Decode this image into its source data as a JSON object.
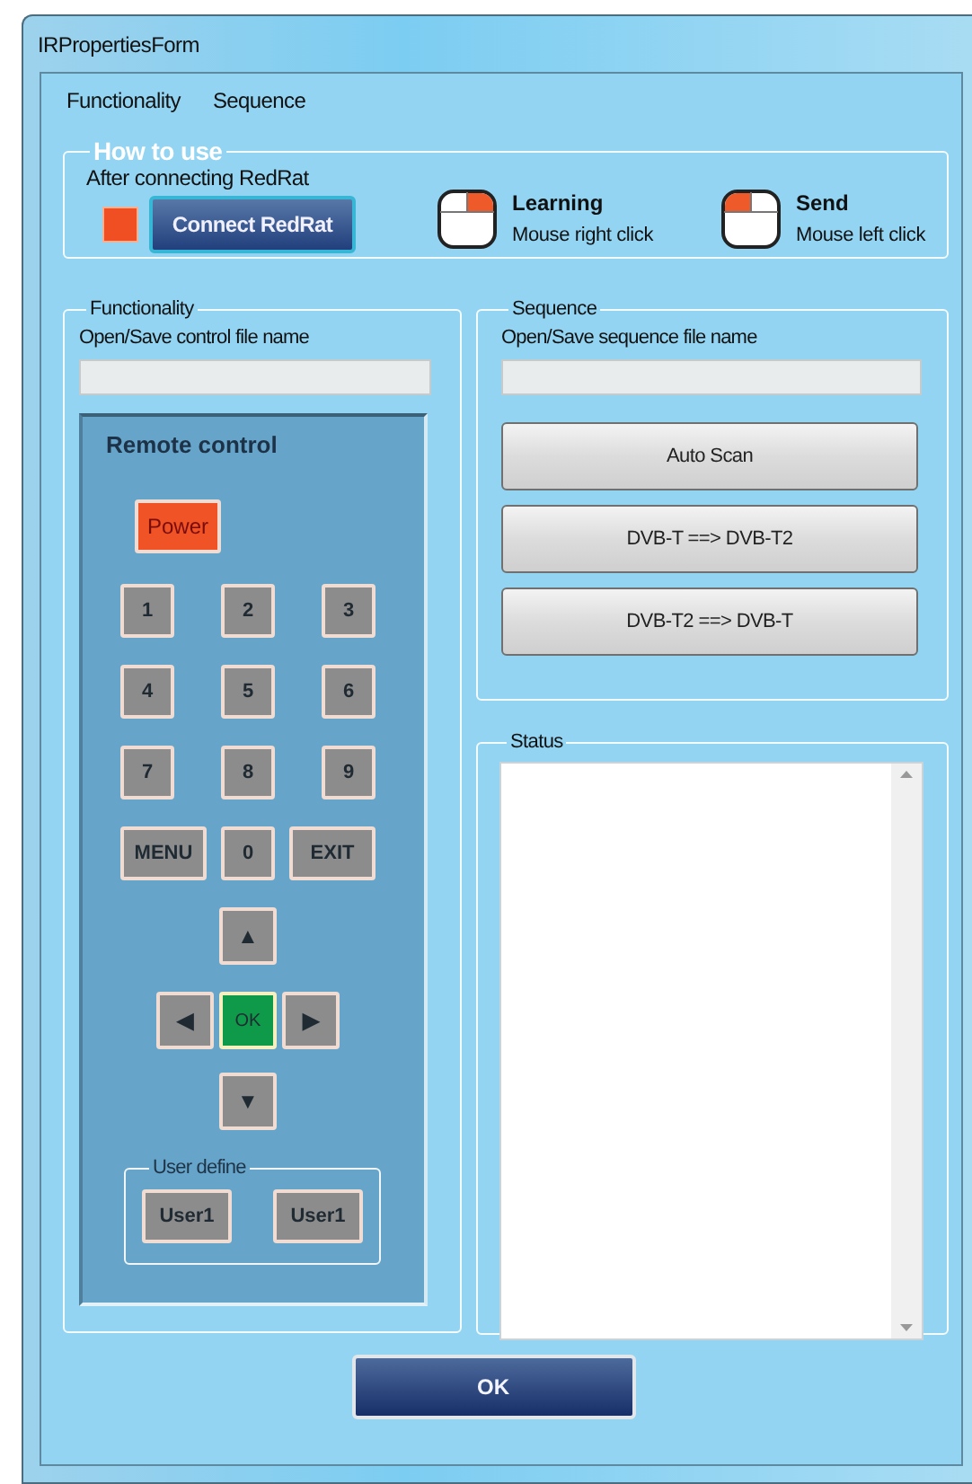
{
  "window": {
    "title": "IRPropertiesForm"
  },
  "menu": [
    {
      "label": "Functionality"
    },
    {
      "label": "Sequence"
    }
  ],
  "how_to_use": {
    "title": "How to use",
    "instruction": "After connecting RedRat",
    "connect_button": "Connect RedRat",
    "hints": [
      {
        "kind": "right",
        "title": "Learning",
        "subtitle": "Mouse right click"
      },
      {
        "kind": "left",
        "title": "Send",
        "subtitle": "Mouse left click"
      }
    ]
  },
  "functionality": {
    "title": "Functionality",
    "file_label": "Open/Save control file name",
    "remote": {
      "title": "Remote control",
      "rows": [
        [
          {
            "label": "Power",
            "kind": "power"
          }
        ],
        [
          {
            "label": "1",
            "kind": "digit"
          },
          {
            "label": "2",
            "kind": "digit"
          },
          {
            "label": "3",
            "kind": "digit"
          }
        ],
        [
          {
            "label": "4",
            "kind": "digit"
          },
          {
            "label": "5",
            "kind": "digit"
          },
          {
            "label": "6",
            "kind": "digit"
          }
        ],
        [
          {
            "label": "7",
            "kind": "digit"
          },
          {
            "label": "8",
            "kind": "digit"
          },
          {
            "label": "9",
            "kind": "digit"
          }
        ],
        [
          {
            "label": "MENU",
            "kind": "wide"
          },
          {
            "label": "0",
            "kind": "digit"
          },
          {
            "label": "EXIT",
            "kind": "wide"
          }
        ],
        [
          {
            "label": "▲",
            "kind": "arrow"
          }
        ],
        [
          {
            "label": "◀",
            "kind": "arrow"
          },
          {
            "label": "OK",
            "kind": "ok"
          },
          {
            "label": "▶",
            "kind": "arrow"
          }
        ],
        [
          {
            "label": "▼",
            "kind": "arrow"
          }
        ]
      ],
      "user_define": {
        "title": "User define",
        "buttons": [
          "User1",
          "User1"
        ]
      }
    }
  },
  "sequence": {
    "title": "Sequence",
    "file_label": "Open/Save sequence file name",
    "buttons": [
      "Auto Scan",
      "DVB-T ==> DVB-T2",
      "DVB-T2 ==> DVB-T"
    ]
  },
  "status": {
    "title": "Status"
  },
  "ok_button": "OK"
}
